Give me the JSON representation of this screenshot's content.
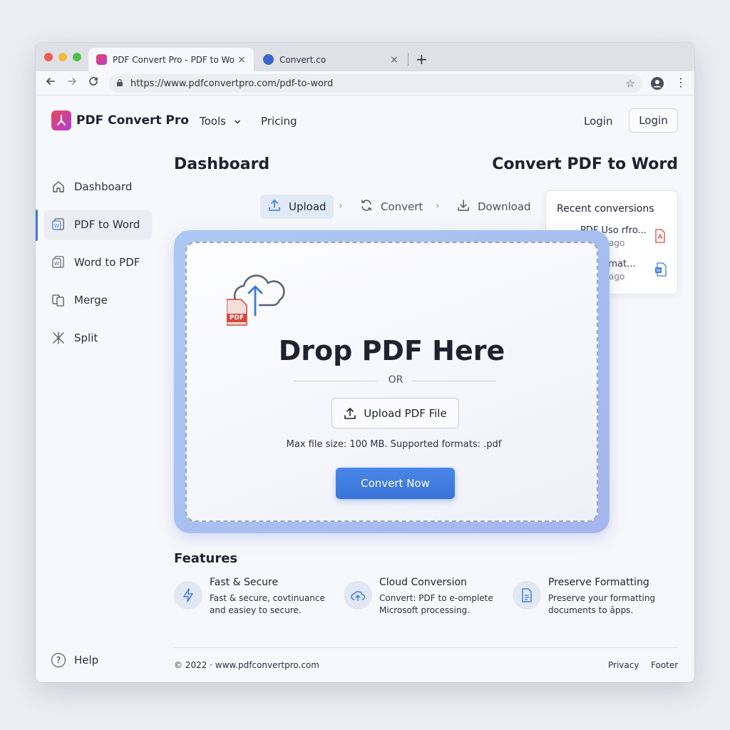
{
  "browser": {
    "tabs": [
      {
        "title": "PDF Convert Pro - PDF to Word",
        "close": "×",
        "active": true
      },
      {
        "title": "Convert.co",
        "close": "×",
        "active": false
      }
    ],
    "new_tab": "+",
    "url": "https://www.pdfconvertpro.com/pdf-to-word",
    "icons": {
      "back": "back-arrow-icon",
      "forward": "forward-arrow-icon",
      "reload": "reload-icon",
      "lock": "lock-icon",
      "star": "bookmark-star-icon",
      "profile": "profile-icon",
      "menu": "kebab-menu-icon"
    }
  },
  "header": {
    "brand": "PDF Convert Pro",
    "nav": {
      "tools": "Tools",
      "pricing": "Pricing"
    },
    "login_text": "Login",
    "login_button": "Login"
  },
  "sidebar": {
    "items": [
      {
        "label": "Dashboard",
        "icon": "home-icon",
        "active": false
      },
      {
        "label": "PDF to Word",
        "icon": "word-doc-icon",
        "active": true
      },
      {
        "label": "Word to PDF",
        "icon": "word-doc-icon",
        "active": false
      },
      {
        "label": "Merge",
        "icon": "merge-icon",
        "active": false
      },
      {
        "label": "Split",
        "icon": "split-icon",
        "active": false
      }
    ],
    "help": "Help"
  },
  "main": {
    "heading_left": "Dashboard",
    "heading_right": "Convert PDF to Word",
    "steps": [
      {
        "label": "Upload",
        "icon": "upload-icon",
        "active": true
      },
      {
        "label": "Convert",
        "icon": "convert-icon",
        "active": false
      },
      {
        "label": "Download",
        "icon": "download-icon",
        "active": false
      }
    ],
    "recent": {
      "title": "Recent conversions",
      "items": [
        {
          "name": "PDF Uso rfro...",
          "time": "ago",
          "icon": "pdf-file-icon"
        },
        {
          "name": "u mat...",
          "time": "ago",
          "icon": "word-file-icon"
        }
      ]
    },
    "dropzone": {
      "pdf_badge": "PDF",
      "title": "Drop PDF Here",
      "or": "OR",
      "upload_button": "Upload PDF File",
      "hint": "Max file size: 100 MB. Supported formats: .pdf",
      "convert_button": "Convert Now"
    },
    "features_heading": "Features",
    "features": [
      {
        "title": "Fast & Secure",
        "desc": "Fast & secure, covtinuance and easiey to secure.",
        "icon": "lightning-icon"
      },
      {
        "title": "Cloud Conversion",
        "desc": "Convert: PDF to e-omplete Microsoft processing.",
        "icon": "cloud-upload-icon"
      },
      {
        "title": "Preserve Formatting",
        "desc": "Preserve your formatting documents to āpps.",
        "icon": "document-icon"
      }
    ]
  },
  "footer": {
    "copyright": "© 2022 · www.pdfconvertpro.com",
    "links": [
      "Privacy",
      "Footer"
    ]
  },
  "colors": {
    "accent": "#3d7be0",
    "pdf_red": "#d9473c",
    "dropzone_border": "#a6c0f0"
  }
}
